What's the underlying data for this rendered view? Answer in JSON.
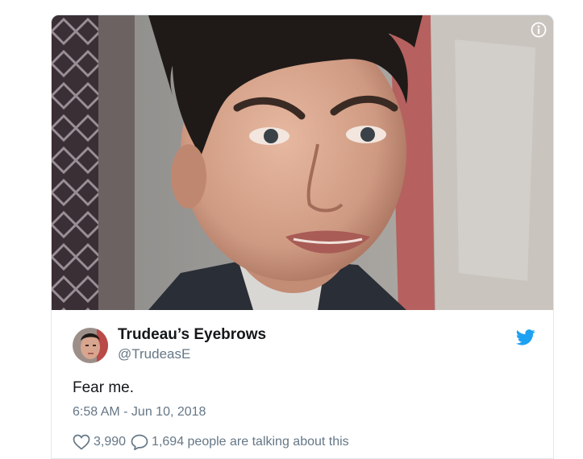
{
  "tweet": {
    "display_name": "Trudeau’s Eyebrows",
    "handle": "@TrudeasE",
    "text": "Fear me.",
    "timestamp": "6:58 AM - Jun 10, 2018",
    "likes": "3,990",
    "talking": "1,694 people are talking about this"
  },
  "icons": {
    "info": "info-icon",
    "bird": "twitter-bird-icon",
    "like": "heart-icon",
    "reply": "speech-bubble-icon"
  },
  "colors": {
    "twitter_blue": "#1da1f2",
    "name_text": "#14171a",
    "secondary_text": "#657786",
    "border": "#e1e8ed"
  }
}
